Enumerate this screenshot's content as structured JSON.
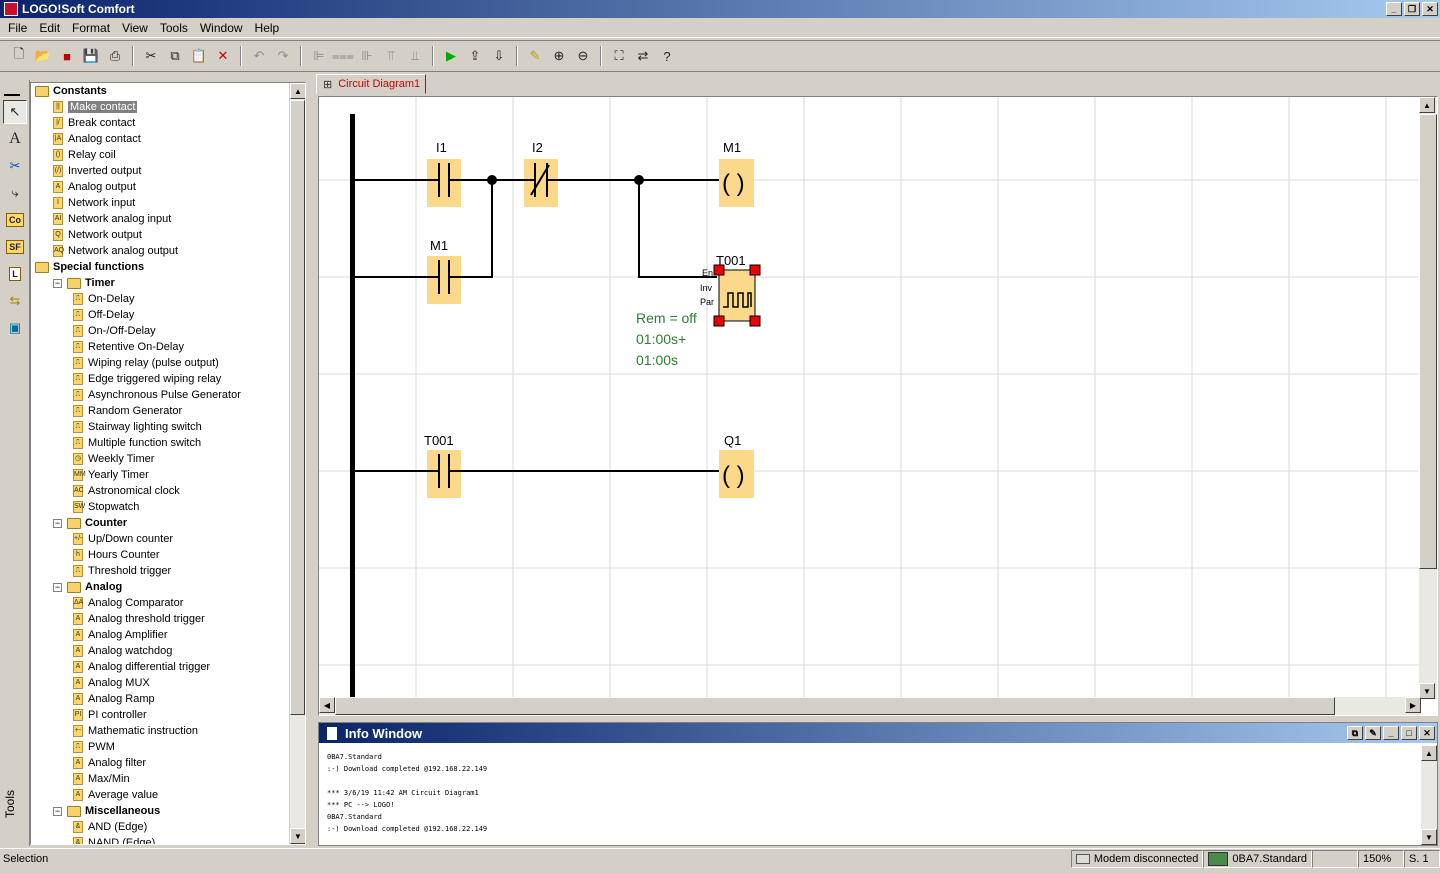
{
  "window": {
    "title": "LOGO!Soft Comfort"
  },
  "menu": [
    "File",
    "Edit",
    "Format",
    "View",
    "Tools",
    "Window",
    "Help"
  ],
  "toolbar": {
    "icons": [
      "new-icon",
      "open-icon",
      "close-file-icon",
      "save-icon",
      "print-icon",
      "cut-icon",
      "copy-icon",
      "paste-icon",
      "delete-icon",
      "undo-icon",
      "redo-icon",
      "align-left-icon",
      "align-center-icon",
      "align-right-icon",
      "align-top-icon",
      "align-middle-icon",
      "simulate-icon",
      "transfer-pc-logo-icon",
      "transfer-logo-pc-icon",
      "highlight-icon",
      "zoom-in-icon",
      "zoom-out-icon",
      "fit-icon",
      "convert-icon",
      "help-icon"
    ]
  },
  "vtools": [
    "select-tool",
    "text-tool",
    "connect-tool",
    "line-tool",
    "Co",
    "SF",
    "L",
    "online-test-tool",
    "network-tool"
  ],
  "tools_label": "Tools",
  "tree": [
    {
      "level": 0,
      "type": "folder",
      "label": "Constants",
      "bold": true
    },
    {
      "level": 1,
      "type": "item",
      "label": "Make contact",
      "icon": "||",
      "selected": true
    },
    {
      "level": 1,
      "type": "item",
      "label": "Break contact",
      "icon": "|/"
    },
    {
      "level": 1,
      "type": "item",
      "label": "Analog contact",
      "icon": "|A"
    },
    {
      "level": 1,
      "type": "item",
      "label": "Relay coil",
      "icon": "()"
    },
    {
      "level": 1,
      "type": "item",
      "label": "Inverted output",
      "icon": "(/)"
    },
    {
      "level": 1,
      "type": "item",
      "label": "Analog output",
      "icon": "A"
    },
    {
      "level": 1,
      "type": "item",
      "label": "Network input",
      "icon": "I"
    },
    {
      "level": 1,
      "type": "item",
      "label": "Network analog input",
      "icon": "AI"
    },
    {
      "level": 1,
      "type": "item",
      "label": "Network output",
      "icon": "Q"
    },
    {
      "level": 1,
      "type": "item",
      "label": "Network analog output",
      "icon": "AQ"
    },
    {
      "level": 0,
      "type": "folder",
      "label": "Special functions",
      "bold": true
    },
    {
      "level": 1,
      "type": "folder",
      "label": "Timer",
      "bold": true,
      "expander": "−"
    },
    {
      "level": 2,
      "type": "item",
      "label": "On-Delay",
      "icon": "⎍"
    },
    {
      "level": 2,
      "type": "item",
      "label": "Off-Delay",
      "icon": "⎍"
    },
    {
      "level": 2,
      "type": "item",
      "label": "On-/Off-Delay",
      "icon": "⎍"
    },
    {
      "level": 2,
      "type": "item",
      "label": "Retentive On-Delay",
      "icon": "⎍"
    },
    {
      "level": 2,
      "type": "item",
      "label": "Wiping relay (pulse output)",
      "icon": "⎍"
    },
    {
      "level": 2,
      "type": "item",
      "label": "Edge triggered wiping relay",
      "icon": "⎍"
    },
    {
      "level": 2,
      "type": "item",
      "label": "Asynchronous Pulse Generator",
      "icon": "⎍"
    },
    {
      "level": 2,
      "type": "item",
      "label": "Random Generator",
      "icon": "⎍"
    },
    {
      "level": 2,
      "type": "item",
      "label": "Stairway lighting switch",
      "icon": "⎍"
    },
    {
      "level": 2,
      "type": "item",
      "label": "Multiple function switch",
      "icon": "⎍"
    },
    {
      "level": 2,
      "type": "item",
      "label": "Weekly Timer",
      "icon": "◷"
    },
    {
      "level": 2,
      "type": "item",
      "label": "Yearly Timer",
      "icon": "MM"
    },
    {
      "level": 2,
      "type": "item",
      "label": "Astronomical clock",
      "icon": "AC"
    },
    {
      "level": 2,
      "type": "item",
      "label": "Stopwatch",
      "icon": "SW"
    },
    {
      "level": 1,
      "type": "folder",
      "label": "Counter",
      "bold": true,
      "expander": "−"
    },
    {
      "level": 2,
      "type": "item",
      "label": "Up/Down counter",
      "icon": "+/-"
    },
    {
      "level": 2,
      "type": "item",
      "label": "Hours Counter",
      "icon": "h"
    },
    {
      "level": 2,
      "type": "item",
      "label": "Threshold trigger",
      "icon": "⎍"
    },
    {
      "level": 1,
      "type": "folder",
      "label": "Analog",
      "bold": true,
      "expander": "−"
    },
    {
      "level": 2,
      "type": "item",
      "label": "Analog Comparator",
      "icon": "ΔA"
    },
    {
      "level": 2,
      "type": "item",
      "label": "Analog threshold trigger",
      "icon": "A"
    },
    {
      "level": 2,
      "type": "item",
      "label": "Analog Amplifier",
      "icon": "A"
    },
    {
      "level": 2,
      "type": "item",
      "label": "Analog watchdog",
      "icon": "A"
    },
    {
      "level": 2,
      "type": "item",
      "label": "Analog differential trigger",
      "icon": "A"
    },
    {
      "level": 2,
      "type": "item",
      "label": "Analog MUX",
      "icon": "A"
    },
    {
      "level": 2,
      "type": "item",
      "label": "Analog Ramp",
      "icon": "A"
    },
    {
      "level": 2,
      "type": "item",
      "label": "PI controller",
      "icon": "PI"
    },
    {
      "level": 2,
      "type": "item",
      "label": "Mathematic instruction",
      "icon": "+-"
    },
    {
      "level": 2,
      "type": "item",
      "label": "PWM",
      "icon": "⎍"
    },
    {
      "level": 2,
      "type": "item",
      "label": "Analog filter",
      "icon": "A"
    },
    {
      "level": 2,
      "type": "item",
      "label": "Max/Min",
      "icon": "A"
    },
    {
      "level": 2,
      "type": "item",
      "label": "Average value",
      "icon": "A"
    },
    {
      "level": 1,
      "type": "folder",
      "label": "Miscellaneous",
      "bold": true,
      "expander": "−"
    },
    {
      "level": 2,
      "type": "item",
      "label": "AND (Edge)",
      "icon": "&"
    },
    {
      "level": 2,
      "type": "item",
      "label": "NAND (Edge)",
      "icon": "&"
    }
  ],
  "tab": {
    "label": "Circuit Diagram1"
  },
  "diagram": {
    "elements": {
      "i1": "I1",
      "i2": "I2",
      "m1_coil": "M1",
      "m1_contact": "M1",
      "t001_block": "T001",
      "t001_contact": "T001",
      "q1": "Q1",
      "pin_en": "En",
      "pin_inv": "Inv",
      "pin_par": "Par",
      "param_rem": "Rem = off",
      "param_time1": "01:00s+",
      "param_time2": "01:00s",
      "coil_symbol": "( )"
    }
  },
  "info_window": {
    "title": "Info Window",
    "lines": [
      "0BA7.Standard",
      ":-) Download completed @192.168.22.149",
      "",
      "*** 3/6/19 11:42 AM Circuit Diagram1",
      "*** PC --> LOGO!",
      "0BA7.Standard",
      ":-) Download completed @192.168.22.149"
    ]
  },
  "status": {
    "left": "Selection",
    "modem": "Modem disconnected",
    "device": "0BA7.Standard",
    "zoom": "150%",
    "page": "S. 1"
  }
}
